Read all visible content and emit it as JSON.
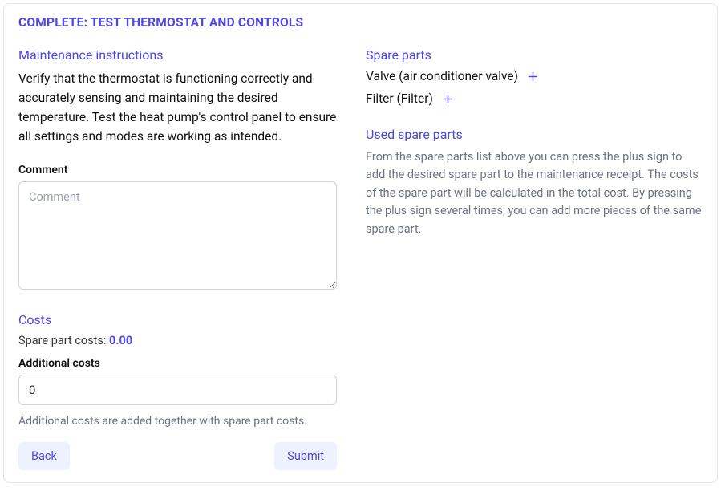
{
  "page_title": "COMPLETE: TEST THERMOSTAT AND CONTROLS",
  "left": {
    "instructions_heading": "Maintenance instructions",
    "instructions_text": "Verify that the thermostat is functioning correctly and accurately sensing and maintaining the desired temperature. Test the heat pump's control panel to ensure all settings and modes are working as intended.",
    "comment_label": "Comment",
    "comment_placeholder": "Comment",
    "comment_value": "",
    "costs_heading": "Costs",
    "spare_part_costs_label": "Spare part costs: ",
    "spare_part_costs_value": "0.00",
    "additional_costs_label": "Additional costs",
    "additional_costs_value": "0",
    "additional_costs_help": "Additional costs are added together with spare part costs.",
    "back_label": "Back",
    "submit_label": "Submit"
  },
  "right": {
    "spare_parts_heading": "Spare parts",
    "spare_parts": [
      {
        "label": "Valve (air conditioner valve)"
      },
      {
        "label": "Filter (Filter)"
      }
    ],
    "used_heading": "Used spare parts",
    "used_description": "From the spare parts list above you can press the plus sign to add the desired spare part to the maintenance receipt. The costs of the spare part will be calculated in the total cost. By pressing the plus sign several times, you can add more pieces of the same spare part."
  }
}
